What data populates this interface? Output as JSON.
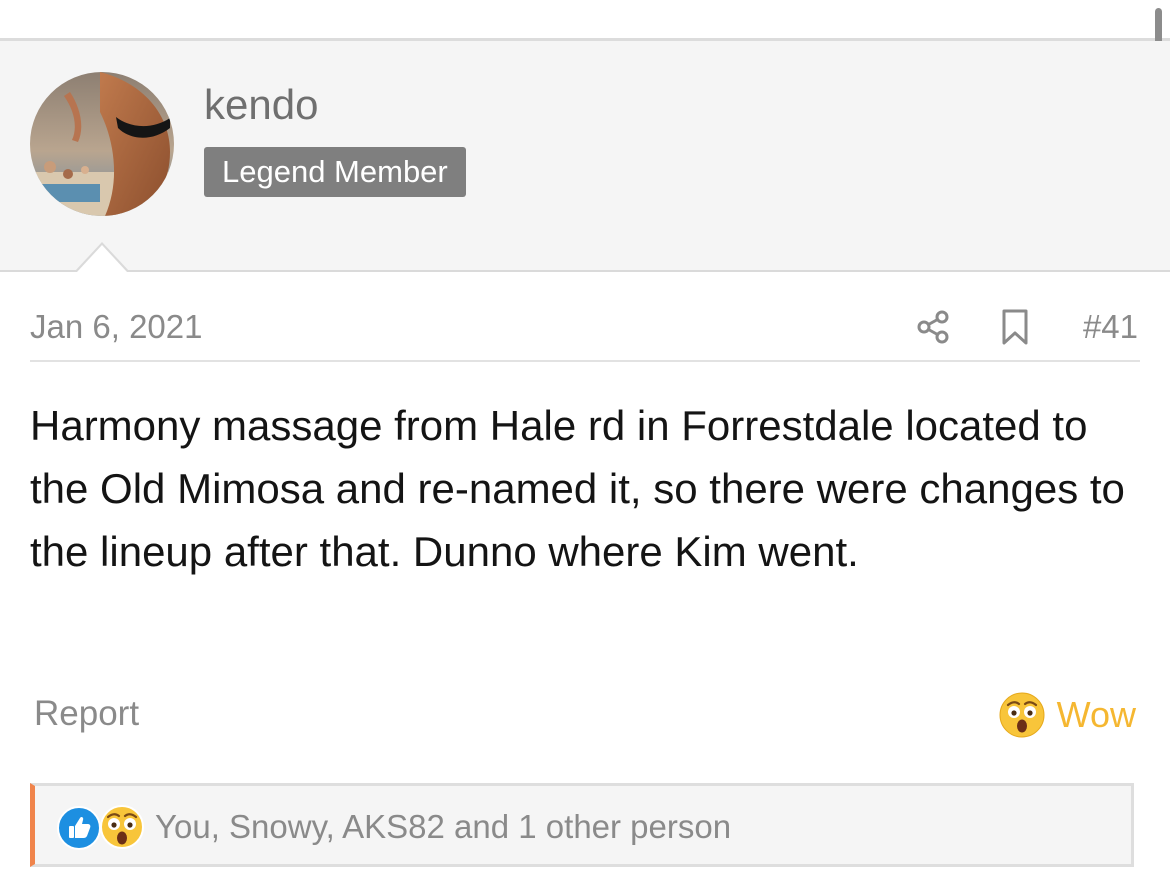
{
  "user": {
    "name": "kendo",
    "title": "Legend Member"
  },
  "post": {
    "date": "Jan 6, 2021",
    "number": "#41",
    "body": "Harmony massage from Hale rd in Forrestdale located to the Old Mimosa and re-named it, so there were changes to the lineup after that. Dunno where Kim went."
  },
  "actions": {
    "report_label": "Report",
    "reaction_label": "Wow",
    "share_icon": "share-icon",
    "bookmark_icon": "bookmark-icon"
  },
  "reactions": {
    "summary": "You, Snowy, AKS82 and 1 other person",
    "icons": [
      "like-icon",
      "wow-icon"
    ]
  },
  "colors": {
    "accent_orange": "#f0844b",
    "wow_yellow": "#f5b731",
    "like_blue": "#1d8fe1",
    "badge_gray": "#7f7f7f"
  }
}
